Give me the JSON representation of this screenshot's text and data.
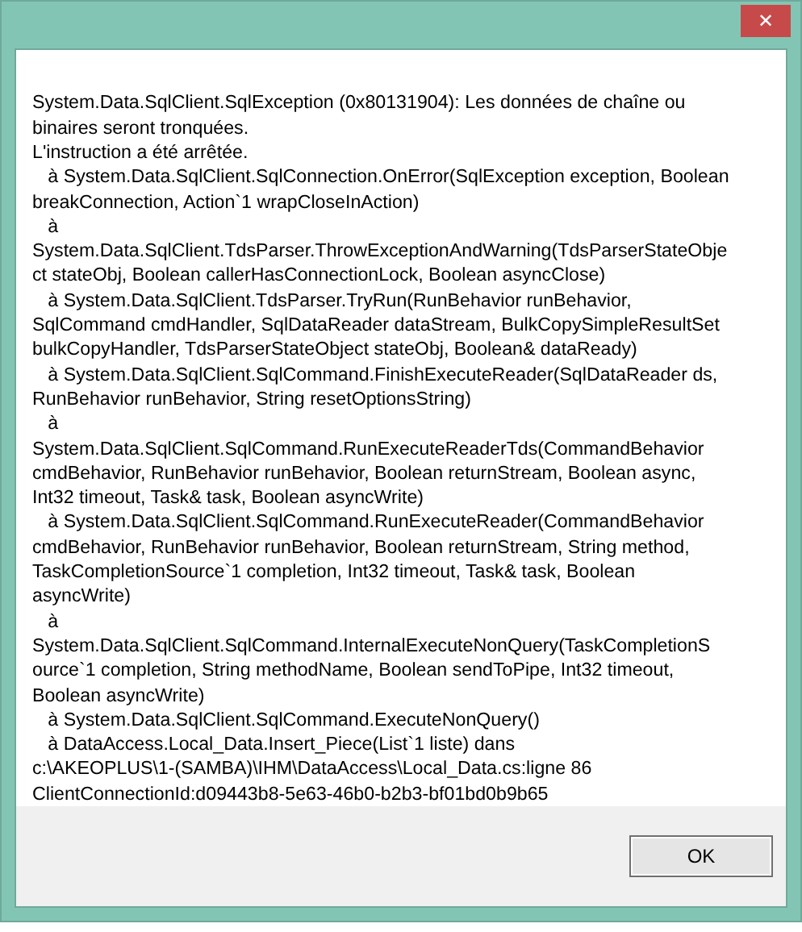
{
  "window": {
    "close": "✕"
  },
  "message": {
    "lines": [
      "System.Data.SqlClient.SqlException (0x80131904): Les données de chaîne ou",
      "binaires seront tronquées.",
      "L'instruction a été arrêtée.",
      "   à System.Data.SqlClient.SqlConnection.OnError(SqlException exception, Boolean",
      "breakConnection, Action`1 wrapCloseInAction)",
      "   à",
      "System.Data.SqlClient.TdsParser.ThrowExceptionAndWarning(TdsParserStateObje",
      "ct stateObj, Boolean callerHasConnectionLock, Boolean asyncClose)",
      "   à System.Data.SqlClient.TdsParser.TryRun(RunBehavior runBehavior,",
      "SqlCommand cmdHandler, SqlDataReader dataStream, BulkCopySimpleResultSet",
      "bulkCopyHandler, TdsParserStateObject stateObj, Boolean& dataReady)",
      "   à System.Data.SqlClient.SqlCommand.FinishExecuteReader(SqlDataReader ds,",
      "RunBehavior runBehavior, String resetOptionsString)",
      "   à",
      "System.Data.SqlClient.SqlCommand.RunExecuteReaderTds(CommandBehavior",
      "cmdBehavior, RunBehavior runBehavior, Boolean returnStream, Boolean async,",
      "Int32 timeout, Task& task, Boolean asyncWrite)",
      "   à System.Data.SqlClient.SqlCommand.RunExecuteReader(CommandBehavior",
      "cmdBehavior, RunBehavior runBehavior, Boolean returnStream, String method,",
      "TaskCompletionSource`1 completion, Int32 timeout, Task& task, Boolean",
      "asyncWrite)",
      "   à",
      "System.Data.SqlClient.SqlCommand.InternalExecuteNonQuery(TaskCompletionS",
      "ource`1 completion, String methodName, Boolean sendToPipe, Int32 timeout,",
      "Boolean asyncWrite)",
      "   à System.Data.SqlClient.SqlCommand.ExecuteNonQuery()",
      "   à DataAccess.Local_Data.Insert_Piece(List`1 liste) dans",
      "c:\\AKEOPLUS\\1-(SAMBA)\\IHM\\DataAccess\\Local_Data.cs:ligne 86",
      "ClientConnectionId:d09443b8-5e63-46b0-b2b3-bf01bd0b9b65"
    ]
  },
  "buttons": [
    "OK"
  ]
}
